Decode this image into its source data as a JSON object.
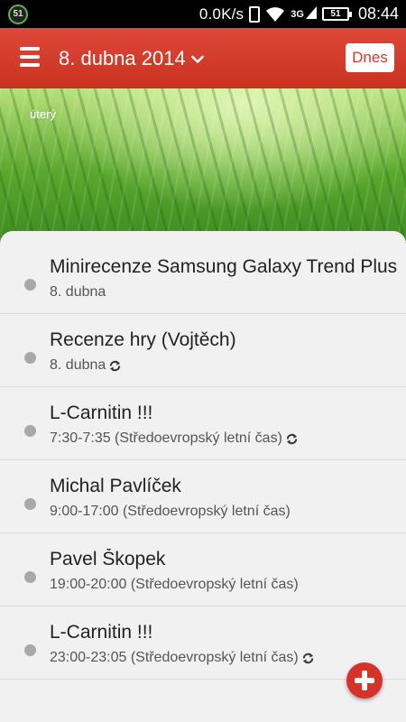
{
  "status_bar": {
    "notification_badge": "51",
    "net_speed": "0.0K/s",
    "network_type": "3G",
    "battery": "51",
    "time": "08:44"
  },
  "app_bar": {
    "date_title": "8. dubna 2014",
    "today_button": "Dnes",
    "accent_color": "#d23a2a"
  },
  "header": {
    "weekday": "úterý"
  },
  "events": [
    {
      "title": "Minirecenze Samsung Galaxy Trend Plus",
      "subtitle": "8. dubna",
      "repeat": false
    },
    {
      "title": "Recenze hry (Vojtěch)",
      "subtitle": "8. dubna",
      "repeat": true
    },
    {
      "title": "L-Carnitin !!!",
      "subtitle": "7:30-7:35 (Středoevropský letní čas)",
      "repeat": true
    },
    {
      "title": "Michal Pavlíček",
      "subtitle": "9:00-17:00 (Středoevropský letní čas)",
      "repeat": false
    },
    {
      "title": "Pavel Škopek",
      "subtitle": "19:00-20:00 (Středoevropský letní čas)",
      "repeat": false
    },
    {
      "title": "L-Carnitin !!!",
      "subtitle": "23:00-23:05 (Středoevropský letní čas)",
      "repeat": true
    }
  ],
  "icons": {
    "menu": "hamburger-icon",
    "dropdown": "chevron-down-icon",
    "repeat": "repeat-icon",
    "add": "plus-icon"
  }
}
